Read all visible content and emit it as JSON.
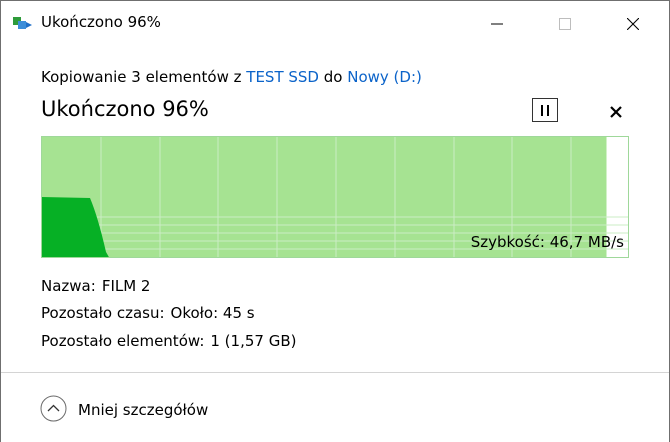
{
  "window": {
    "title": "Ukończono 96%",
    "controls": {
      "minimize_icon": "minimize-icon",
      "maximize_icon": "maximize-icon",
      "close_icon": "close-icon"
    }
  },
  "header": {
    "prefix": "Kopiowanie 3 elementów z ",
    "source_link": "TEST SSD",
    "middle": " do ",
    "destination_link": "Nowy (D:)",
    "heading": "Ukończono 96%",
    "link_color": "#0b63c9"
  },
  "progress": {
    "percent": 96,
    "speed_label": "Szybkość: 46,7 MB/s",
    "colors": {
      "progress_fill": "#a6e392",
      "speed_area": "#06b025",
      "grid": "#cbedc4"
    }
  },
  "details": {
    "name_label": "Nazwa:",
    "name_value": "FILM 2",
    "time_label": "Pozostało czasu:",
    "time_value": "Około: 45 s",
    "items_label": "Pozostało elementów:",
    "items_value": "1 (1,57 GB)"
  },
  "footer": {
    "toggle_label": "Mniej szczegółów",
    "toggle_icon": "chevron-up-circle-icon"
  }
}
